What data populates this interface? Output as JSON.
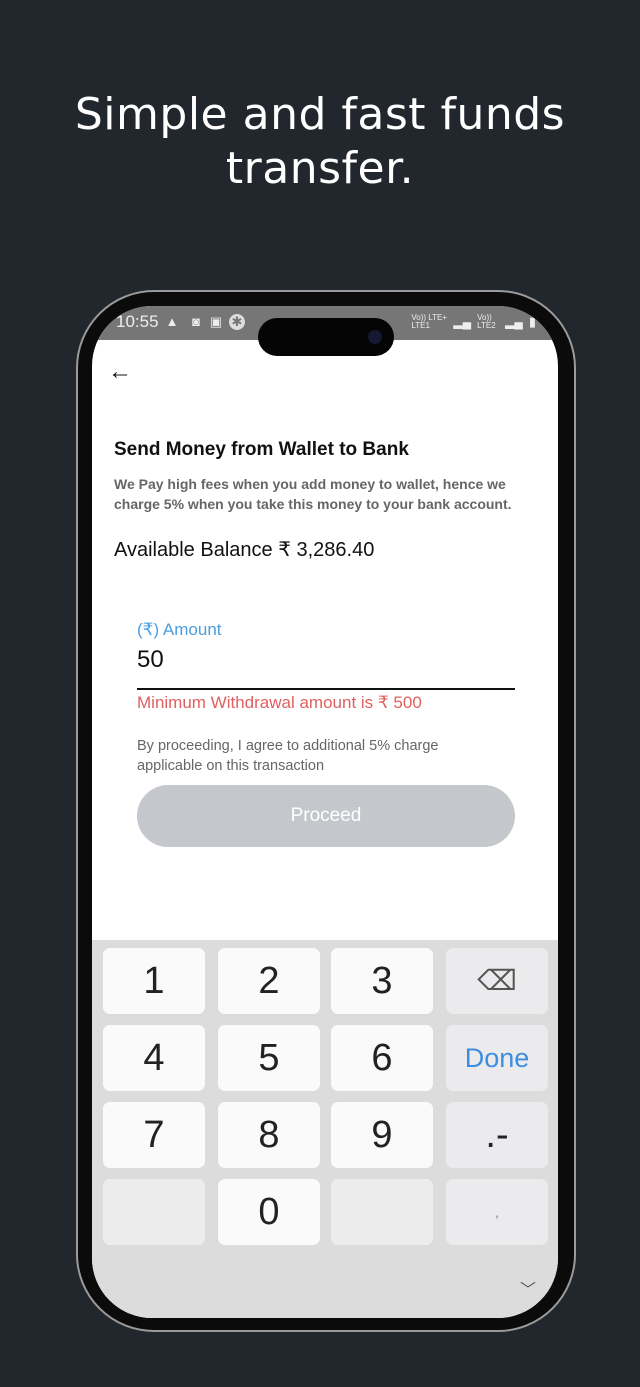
{
  "headline": "Simple and fast funds transfer.",
  "status_bar": {
    "time": "10:55",
    "icons": [
      "warning-icon",
      "wifi-icon",
      "image-icon",
      "pinwheel-icon"
    ],
    "network": [
      "Vo)) LTE+ LTE1",
      "Vo)) LTE2"
    ],
    "battery": "charging"
  },
  "page": {
    "back_icon": "arrow-left-icon",
    "title": "Send Money from Wallet to Bank",
    "description": "We Pay high fees when you add money to wallet, hence we charge 5% when you take this money to your bank account.",
    "balance": "Available Balance ₹ 3,286.40"
  },
  "amount": {
    "label": "(₹) Amount",
    "value": "50",
    "error": "Minimum Withdrawal amount is ₹ 500"
  },
  "agreement": "By proceeding, I agree to additional 5% charge applicable on this transaction",
  "proceed_label": "Proceed",
  "keyboard": {
    "keys": [
      "1",
      "2",
      "3",
      "⌫",
      "4",
      "5",
      "6",
      "Done",
      "7",
      "8",
      "9",
      ".-",
      "",
      "0",
      "",
      ","
    ],
    "colors": {
      "done": "#3d8ee0"
    }
  }
}
